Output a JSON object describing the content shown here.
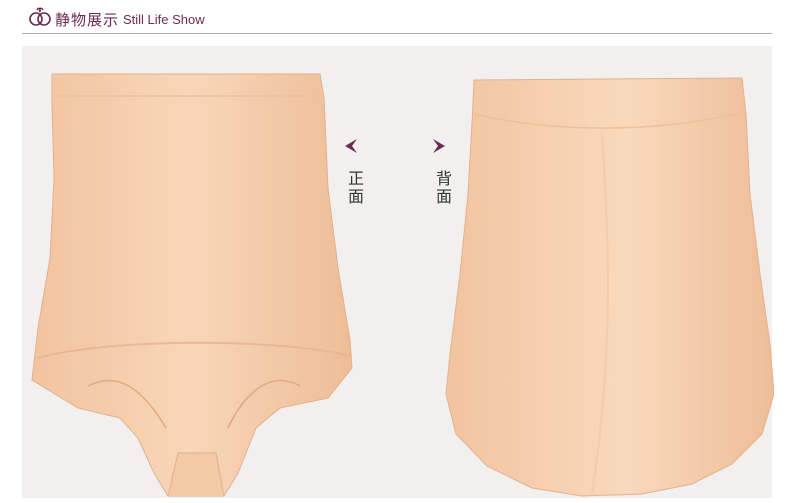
{
  "header": {
    "logo_icon": "flower-logo-icon",
    "title_cn": "静物展示",
    "title_en": "Still Life Show",
    "accent_color": "#6a2a55"
  },
  "views": {
    "front_label": "正面",
    "back_label": "背面",
    "front_arrow_icon": "triangle-left-icon",
    "back_arrow_icon": "triangle-right-icon"
  },
  "product": {
    "subject": "nude high-waist shaping briefs",
    "color": "#f6cfae"
  }
}
